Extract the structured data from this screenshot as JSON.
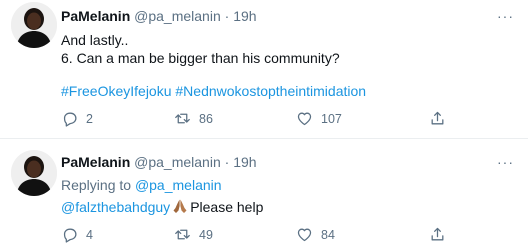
{
  "tweets": [
    {
      "name": "PaMelanin",
      "handle": "@pa_melanin",
      "separator": "·",
      "time": "19h",
      "lines": [
        "And lastly..",
        "6. Can a man be bigger than his community?"
      ],
      "hashtags": [
        "#FreeOkeyIfejoku",
        "#Nednwokostoptheintimidation"
      ],
      "replies": "2",
      "retweets": "86",
      "likes": "107"
    },
    {
      "name": "PaMelanin",
      "handle": "@pa_melanin",
      "separator": "·",
      "time": "19h",
      "replying_prefix": "Replying to",
      "replying_to": "@pa_melanin",
      "mention": "@falzthebahdguy",
      "text": "Please help",
      "replies": "4",
      "retweets": "49",
      "likes": "84"
    }
  ],
  "more_label": "···",
  "icons": {
    "reply": "reply-icon",
    "retweet": "retweet-icon",
    "like": "heart-icon",
    "share": "share-icon",
    "emoji": "folded-hands-emoji"
  },
  "colors": {
    "link": "#1b95e0",
    "muted": "#5b7083",
    "text": "#0f1419"
  }
}
